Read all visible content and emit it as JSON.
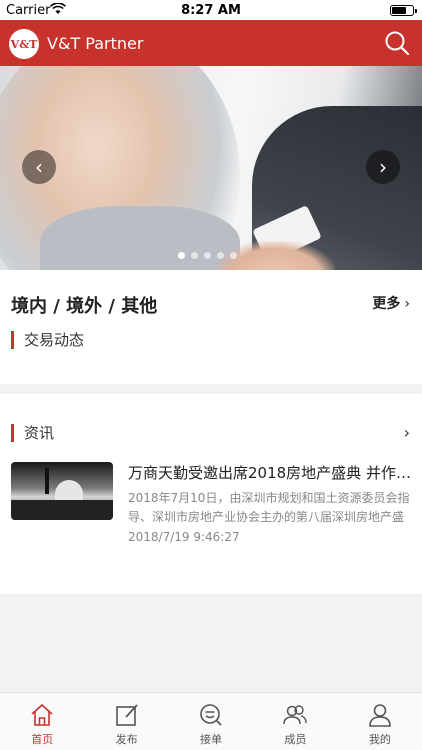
{
  "status_bar": {
    "carrier": "Carrier",
    "time": "8:27 AM"
  },
  "header": {
    "logo_text": "V&T",
    "title": "V&T Partner"
  },
  "banner": {
    "total_slides": 5,
    "active_index": 0
  },
  "section_deals": {
    "title": "境内 / 境外 / 其他",
    "more_label": "更多",
    "sub_heading": "交易动态"
  },
  "section_news": {
    "heading": "资讯",
    "items": [
      {
        "title": "万商天勤受邀出席2018房地产盛典 并作主…",
        "snippet": "2018年7月10日，由深圳市规划和国土资源委员会指导、深圳市房地产业协会主办的第八届深圳房地产盛",
        "time": "2018/7/19 9:46:27"
      }
    ]
  },
  "tab_bar": {
    "active": "home",
    "tabs": [
      {
        "id": "home",
        "label": "首页",
        "icon": "home-icon"
      },
      {
        "id": "publish",
        "label": "发布",
        "icon": "edit-icon"
      },
      {
        "id": "orders",
        "label": "接单",
        "icon": "search-chat-icon"
      },
      {
        "id": "members",
        "label": "成员",
        "icon": "users-icon"
      },
      {
        "id": "mine",
        "label": "我的",
        "icon": "user-icon"
      }
    ]
  },
  "colors": {
    "accent": "#c8322c",
    "text_muted": "#888888"
  }
}
